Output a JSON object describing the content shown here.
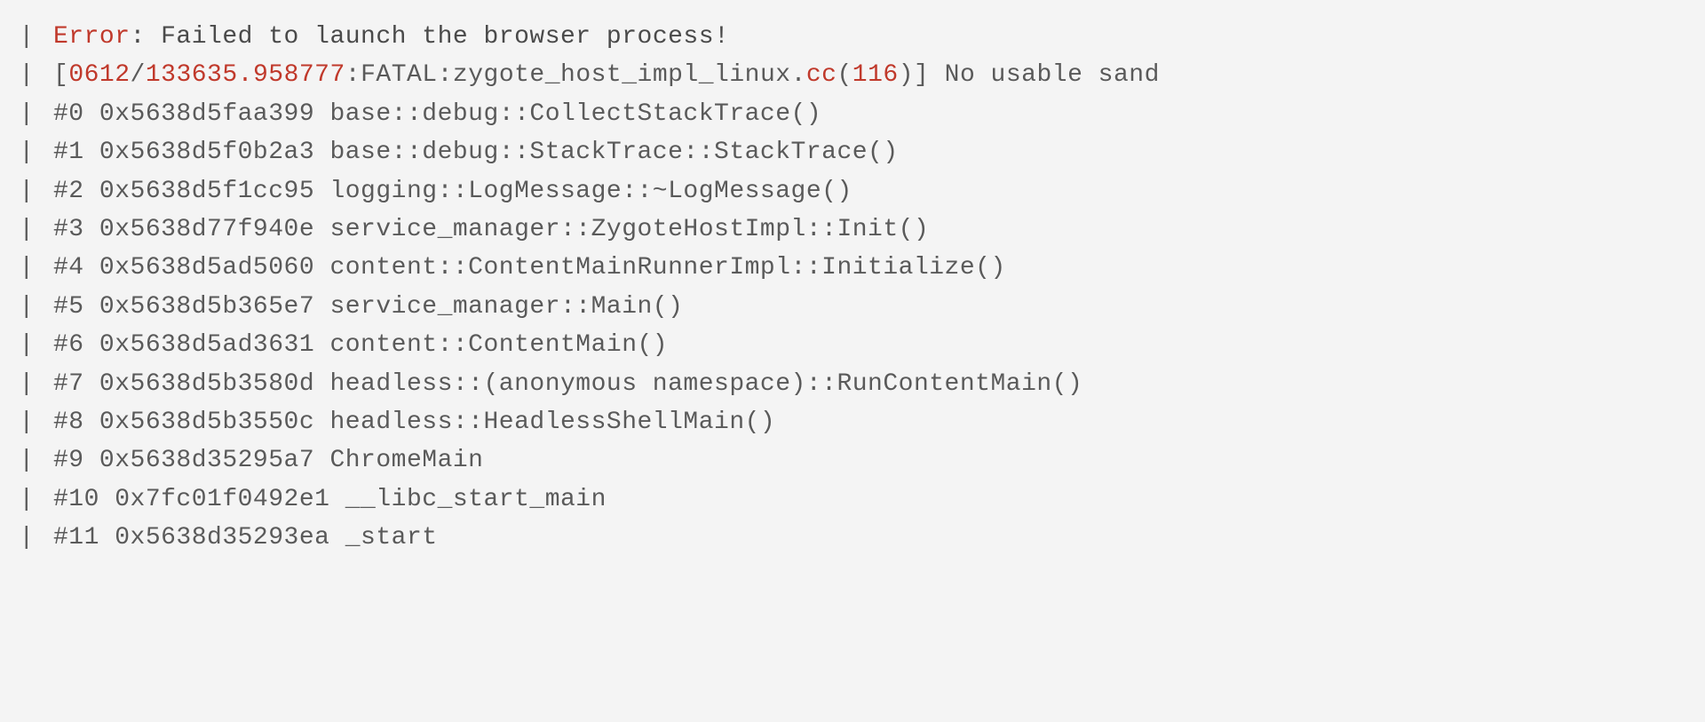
{
  "pipe": "|",
  "error": {
    "label": "Error",
    "colon": ": ",
    "message": "Failed to launch the browser process!"
  },
  "fatal": {
    "open_bracket": "[",
    "timestamp1": "0612",
    "slash": "/",
    "timestamp2": "133635.958777",
    "colon_fatal": ":FATAL:",
    "file": "zygote_host_impl_linux.",
    "ext": "cc",
    "paren_open": "(",
    "line_num": "116",
    "paren_close": ")",
    "close_bracket": "]",
    "msg": " No usable sand"
  },
  "frames": [
    {
      "text": "#0 0x5638d5faa399 base::debug::CollectStackTrace()"
    },
    {
      "text": "#1 0x5638d5f0b2a3 base::debug::StackTrace::StackTrace()"
    },
    {
      "text": "#2 0x5638d5f1cc95 logging::LogMessage::~LogMessage()"
    },
    {
      "text": "#3 0x5638d77f940e service_manager::ZygoteHostImpl::Init()"
    },
    {
      "text": "#4 0x5638d5ad5060 content::ContentMainRunnerImpl::Initialize()"
    },
    {
      "text": "#5 0x5638d5b365e7 service_manager::Main()"
    },
    {
      "text": "#6 0x5638d5ad3631 content::ContentMain()"
    },
    {
      "text": "#7 0x5638d5b3580d headless::(anonymous namespace)::RunContentMain()"
    },
    {
      "text": "#8 0x5638d5b3550c headless::HeadlessShellMain()"
    },
    {
      "text": "#9 0x5638d35295a7 ChromeMain"
    },
    {
      "text": "#10 0x7fc01f0492e1 __libc_start_main"
    },
    {
      "text": "#11 0x5638d35293ea _start"
    }
  ]
}
